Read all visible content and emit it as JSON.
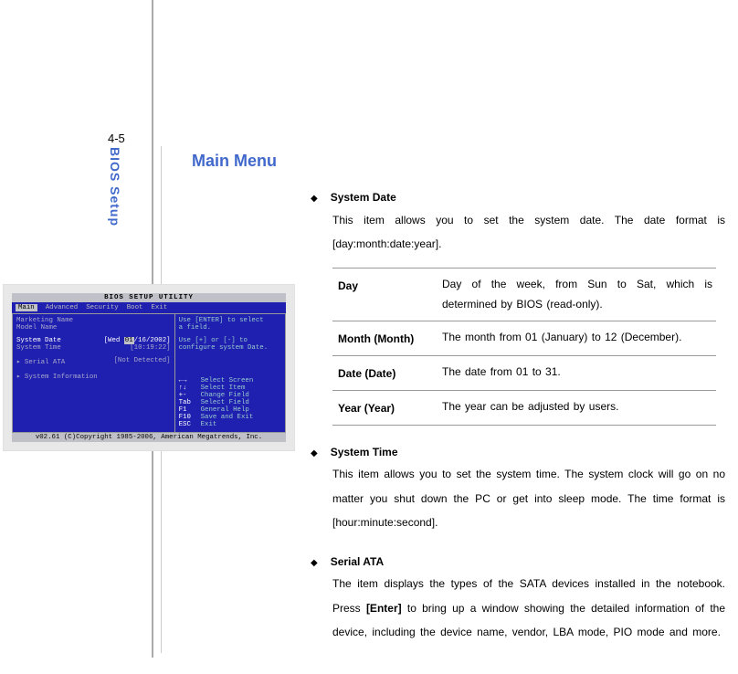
{
  "page": {
    "number": "4-5",
    "side_label": "BIOS Setup",
    "heading": "Main Menu"
  },
  "sections": [
    {
      "title": "System Date",
      "body": "This item allows you to set the system date.   The date format is [day:month:date:year]."
    },
    {
      "title": "System Time",
      "body": "This item allows you to set the system time.   The system clock will go on no matter you shut down the PC or get into sleep mode.   The time format is [hour:minute:second]."
    },
    {
      "title": "Serial ATA",
      "body_pre": "The item displays the types of the SATA devices installed in the notebook. Press ",
      "body_bold": "[Enter]",
      "body_post": " to bring up a window showing the detailed information of the device, including the device name, vendor, LBA mode, PIO mode and more."
    }
  ],
  "table": [
    {
      "label": "Day",
      "desc": "Day of the week, from Sun to Sat, which is determined by BIOS (read-only)."
    },
    {
      "label": "Month (Month)",
      "desc": "The month from 01 (January) to 12 (December)."
    },
    {
      "label": "Date (Date)",
      "desc": "The date from 01 to 31."
    },
    {
      "label": "Year (Year)",
      "desc": "The year can be adjusted by users."
    }
  ],
  "bios": {
    "title": "BIOS SETUP UTILITY",
    "menu": [
      "Main",
      "Advanced",
      "Security",
      "Boot",
      "Exit"
    ],
    "left": {
      "r1": "Marketing Name",
      "r2": "Model Name",
      "sysdate_label": "System Date",
      "sysdate_value_pre": "[Wed ",
      "sysdate_value_sel": "01",
      "sysdate_value_post": "/16/2002]",
      "systime_label": "System Time",
      "systime_value": "[10:19:22]",
      "sata_label": "▸ Serial ATA",
      "sata_value": "[Not Detected]",
      "sysinfo": "▸ System Information"
    },
    "right": {
      "top1": "Use [ENTER] to select",
      "top2": "a field.",
      "top4": "Use [+] or [-] to",
      "top5": "configure system Date.",
      "keys": [
        {
          "k": "←→",
          "d": "Select Screen"
        },
        {
          "k": "↑↓",
          "d": "Select Item"
        },
        {
          "k": "+-",
          "d": "Change Field"
        },
        {
          "k": "Tab",
          "d": "Select Field"
        },
        {
          "k": "F1",
          "d": "General Help"
        },
        {
          "k": "F10",
          "d": "Save and Exit"
        },
        {
          "k": "ESC",
          "d": "Exit"
        }
      ]
    },
    "footer": "v02.61 (C)Copyright 1985-2006, American Megatrends, Inc."
  }
}
